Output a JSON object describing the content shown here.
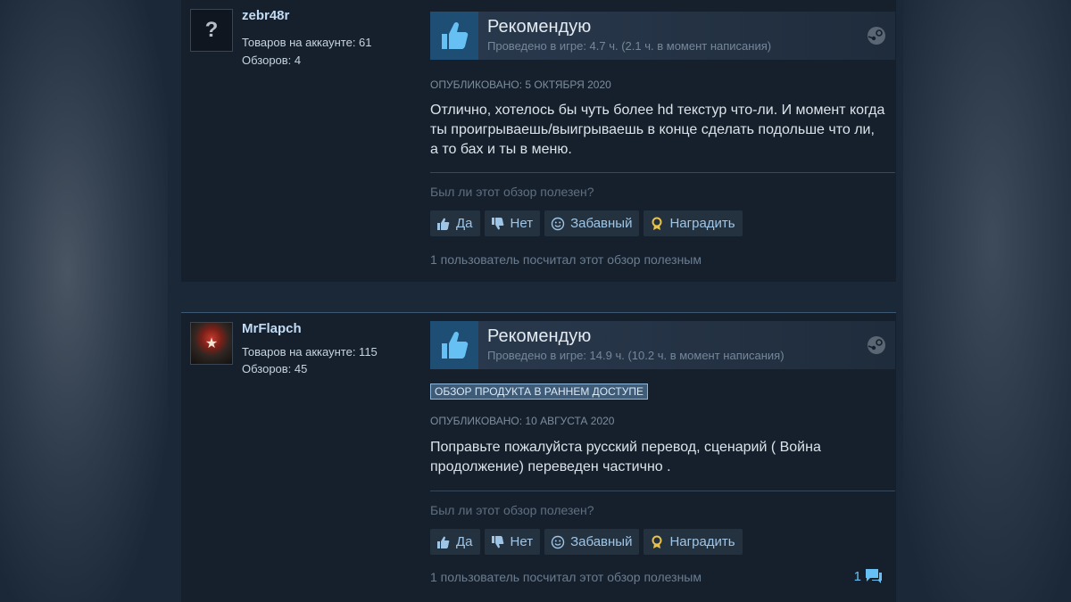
{
  "reviews": [
    {
      "author": {
        "name": "zebr48r",
        "avatar_placeholder": "?",
        "products_label": "Товаров на аккаунте: 61",
        "reviews_label": "Обзоров: 4"
      },
      "verdict": "Рекомендую",
      "hours": "Проведено в игре: 4.7 ч. (2.1 ч. в момент написания)",
      "early_access_badge": "",
      "posted": "ОПУБЛИКОВАНО: 5 ОКТЯБРЯ 2020",
      "text": "Отлично, хотелось бы чуть более hd текстур что-ли. И момент когда ты проигрываешь/выигрываешь в конце сделать подольше что ли, а то бах и ты в меню.",
      "helpful_question": "Был ли этот обзор полезен?",
      "buttons": {
        "yes": "Да",
        "no": "Нет",
        "funny": "Забавный",
        "award": "Наградить"
      },
      "helpful_count": "1 пользователь посчитал этот обзор полезным",
      "comment_count": ""
    },
    {
      "author": {
        "name": "MrFlapch",
        "products_label": "Товаров на аккаунте: 115",
        "reviews_label": "Обзоров: 45"
      },
      "verdict": "Рекомендую",
      "hours": "Проведено в игре: 14.9 ч. (10.2 ч. в момент написания)",
      "early_access_badge": "ОБЗОР ПРОДУКТА В РАННЕМ ДОСТУПЕ",
      "posted": "ОПУБЛИКОВАНО: 10 АВГУСТА 2020",
      "text": "Поправьте пожалуйста русский перевод, сценарий ( Война продолжение) переведен частично .",
      "helpful_question": "Был ли этот обзор полезен?",
      "buttons": {
        "yes": "Да",
        "no": "Нет",
        "funny": "Забавный",
        "award": "Наградить"
      },
      "helpful_count": "1 пользователь посчитал этот обзор полезным",
      "comment_count": "1"
    }
  ],
  "colors": {
    "page_bg": "#1b2838",
    "card_bg": "#16202d",
    "accent": "#66c0f4",
    "username": "#c1dbf4",
    "thumb_bg": "#1e4e74"
  },
  "icons": [
    "thumbs-up-icon",
    "thumbs-down-icon",
    "smiley-icon",
    "award-ribbon-icon",
    "steam-logo-icon",
    "comment-bubble-icon"
  ]
}
